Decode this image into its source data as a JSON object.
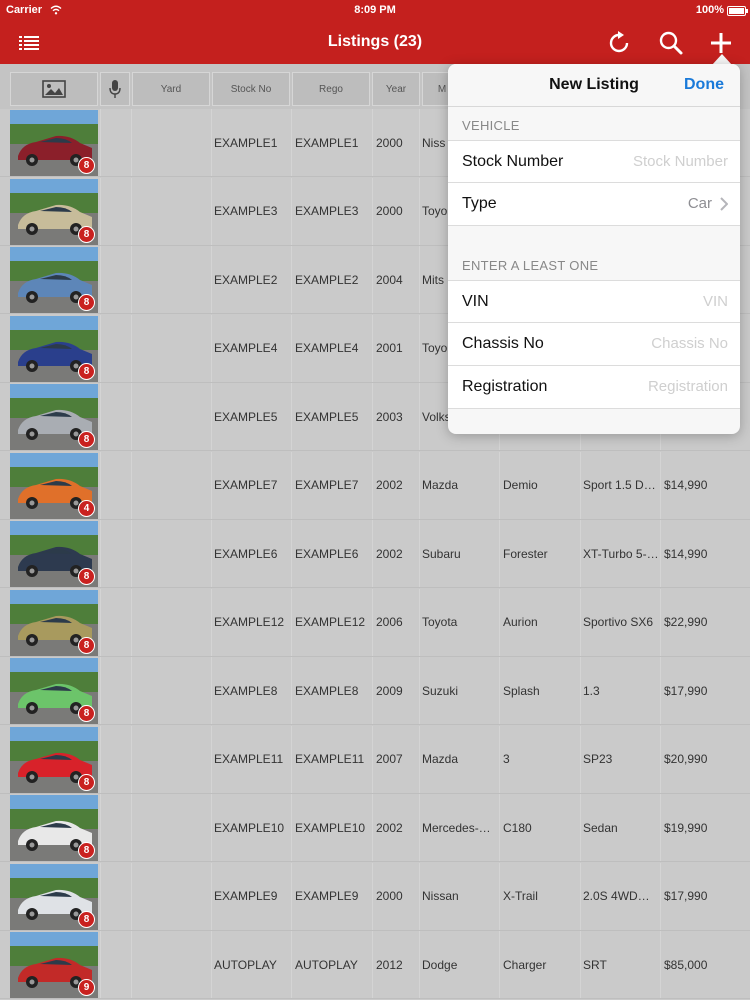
{
  "status": {
    "carrier": "Carrier",
    "time": "8:09 PM",
    "battery": "100%"
  },
  "nav": {
    "title": "Listings (23)",
    "icons": [
      "list-icon",
      "refresh-icon",
      "search-icon",
      "plus-icon"
    ]
  },
  "table": {
    "headers": [
      "Yard",
      "Stock No",
      "Rego",
      "Year",
      "M"
    ],
    "rows": [
      {
        "stock": "EXAMPLE1",
        "rego": "EXAMPLE1",
        "year": "2000",
        "make": "Niss",
        "model": "",
        "variant": "",
        "price": "",
        "photos": "8",
        "color": "#8b1f2a"
      },
      {
        "stock": "EXAMPLE3",
        "rego": "EXAMPLE3",
        "year": "2000",
        "make": "Toyo",
        "model": "",
        "variant": "",
        "price": "",
        "photos": "8",
        "color": "#c7bc9a"
      },
      {
        "stock": "EXAMPLE2",
        "rego": "EXAMPLE2",
        "year": "2004",
        "make": "Mits",
        "model": "",
        "variant": "",
        "price": "",
        "photos": "8",
        "color": "#5d86b8"
      },
      {
        "stock": "EXAMPLE4",
        "rego": "EXAMPLE4",
        "year": "2001",
        "make": "Toyo",
        "model": "",
        "variant": "",
        "price": "",
        "photos": "8",
        "color": "#2a3f8c"
      },
      {
        "stock": "EXAMPLE5",
        "rego": "EXAMPLE5",
        "year": "2003",
        "make": "Volks",
        "model": "",
        "variant": "",
        "price": "",
        "photos": "8",
        "color": "#a9adb3"
      },
      {
        "stock": "EXAMPLE7",
        "rego": "EXAMPLE7",
        "year": "2002",
        "make": "Mazda",
        "model": "Demio",
        "variant": "Sport 1.5 D…",
        "price": "$14,990",
        "photos": "4",
        "color": "#e0702a"
      },
      {
        "stock": "EXAMPLE6",
        "rego": "EXAMPLE6",
        "year": "2002",
        "make": "Subaru",
        "model": "Forester",
        "variant": "XT-Turbo 5-…",
        "price": "$14,990",
        "photos": "8",
        "color": "#2d3a4f"
      },
      {
        "stock": "EXAMPLE12",
        "rego": "EXAMPLE12",
        "year": "2006",
        "make": "Toyota",
        "model": "Aurion",
        "variant": "Sportivo SX6",
        "price": "$22,990",
        "photos": "8",
        "color": "#a89a5e"
      },
      {
        "stock": "EXAMPLE8",
        "rego": "EXAMPLE8",
        "year": "2009",
        "make": "Suzuki",
        "model": "Splash",
        "variant": "1.3",
        "price": "$17,990",
        "photos": "8",
        "color": "#6cc46a"
      },
      {
        "stock": "EXAMPLE11",
        "rego": "EXAMPLE11",
        "year": "2007",
        "make": "Mazda",
        "model": "3",
        "variant": "SP23",
        "price": "$20,990",
        "photos": "8",
        "color": "#d8222a"
      },
      {
        "stock": "EXAMPLE10",
        "rego": "EXAMPLE10",
        "year": "2002",
        "make": "Mercedes-…",
        "model": "C180",
        "variant": "Sedan",
        "price": "$19,990",
        "photos": "8",
        "color": "#e8e8e8"
      },
      {
        "stock": "EXAMPLE9",
        "rego": "EXAMPLE9",
        "year": "2000",
        "make": "Nissan",
        "model": "X-Trail",
        "variant": "2.0S 4WD…",
        "price": "$17,990",
        "photos": "8",
        "color": "#dfe2e6"
      },
      {
        "stock": "AUTOPLAY",
        "rego": "AUTOPLAY",
        "year": "2012",
        "make": "Dodge",
        "model": "Charger",
        "variant": "SRT",
        "price": "$85,000",
        "photos": "9",
        "color": "#c22a28"
      }
    ]
  },
  "popover": {
    "title": "New Listing",
    "done": "Done",
    "section1": "VEHICLE",
    "stock_label": "Stock Number",
    "stock_placeholder": "Stock Number",
    "type_label": "Type",
    "type_value": "Car",
    "section2": "ENTER A LEAST ONE",
    "vin_label": "VIN",
    "vin_placeholder": "VIN",
    "chassis_label": "Chassis No",
    "chassis_placeholder": "Chassis No",
    "reg_label": "Registration",
    "reg_placeholder": "Registration"
  }
}
